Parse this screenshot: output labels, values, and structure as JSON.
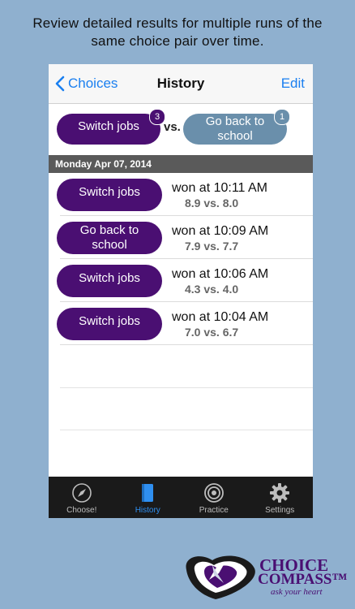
{
  "caption": {
    "line1": "Review detailed results for multiple runs of the",
    "line2": "same choice pair over time."
  },
  "navbar": {
    "back_label": "Choices",
    "title": "History",
    "edit_label": "Edit"
  },
  "pair": {
    "left": {
      "label_line1": "Switch jobs",
      "label_line2": "",
      "badge": "3"
    },
    "vs": "vs.",
    "right": {
      "label_line1": "Go back to",
      "label_line2": "school",
      "badge": "1"
    }
  },
  "section_header": "Monday Apr 07, 2014",
  "rows": [
    {
      "choice_line1": "Switch jobs",
      "choice_line2": "",
      "winner": "purple",
      "result": "won at 10:11 AM",
      "scores": "8.9 vs. 8.0"
    },
    {
      "choice_line1": "Go back to",
      "choice_line2": "school",
      "winner": "purple",
      "result": "won at 10:09 AM",
      "scores": "7.9 vs. 7.7"
    },
    {
      "choice_line1": "Switch jobs",
      "choice_line2": "",
      "winner": "purple",
      "result": "won at 10:06 AM",
      "scores": "4.3 vs. 4.0"
    },
    {
      "choice_line1": "Switch jobs",
      "choice_line2": "",
      "winner": "purple",
      "result": "won at 10:04 AM",
      "scores": "7.0 vs. 6.7"
    }
  ],
  "tabs": [
    {
      "label": "Choose!",
      "icon": "compass-icon",
      "active": false
    },
    {
      "label": "History",
      "icon": "book-icon",
      "active": true
    },
    {
      "label": "Practice",
      "icon": "target-icon",
      "active": false
    },
    {
      "label": "Settings",
      "icon": "gear-icon",
      "active": false
    }
  ],
  "logo": {
    "line1": "CHOICE",
    "line2": "COMPASS™",
    "tagline": "ask your heart"
  },
  "colors": {
    "background": "#8fb0cf",
    "purple": "#4a0f72",
    "blue": "#6a8fab",
    "ios_blue": "#1a7ff0",
    "tab_active": "#2f8ff0"
  }
}
